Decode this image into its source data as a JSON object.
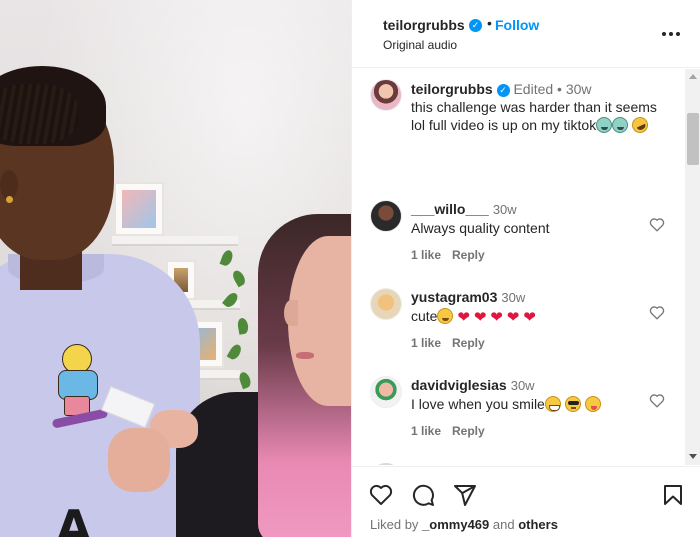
{
  "header": {
    "username": "teilorgrubbs",
    "separator": "•",
    "follow_label": "Follow",
    "audio_label": "Original audio",
    "more_icon": "more-horizontal-icon"
  },
  "caption": {
    "username": "teilorgrubbs",
    "edited_label": "Edited",
    "separator": "•",
    "time": "30w",
    "text": "this challenge was harder than it seems lol full video is up on my tiktok",
    "emojis": [
      "crying-face",
      "crying-face",
      "rolling-on-floor-laughing"
    ]
  },
  "comments": [
    {
      "username": "___willo___",
      "time": "30w",
      "text": "Always quality content",
      "likes": "1 like",
      "reply_label": "Reply"
    },
    {
      "username": "yustagram03",
      "time": "30w",
      "text": "cute",
      "emojis": [
        "smiling-face",
        "heart",
        "heart",
        "heart",
        "heart",
        "heart"
      ],
      "likes": "1 like",
      "reply_label": "Reply"
    },
    {
      "username": "davidviglesias",
      "time": "30w",
      "text": "I love when you smile",
      "emojis": [
        "grinning-face",
        "sunglasses-face",
        "zany-face"
      ],
      "likes": "1 like",
      "reply_label": "Reply"
    }
  ],
  "actions": {
    "icons": [
      "heart-icon",
      "comment-icon",
      "share-icon",
      "bookmark-icon"
    ],
    "liked_by_prefix": "Liked by",
    "liked_by_user": "_ommy469",
    "liked_by_and": "and",
    "liked_by_others": "others"
  },
  "video": {
    "overlay_text": "A"
  },
  "colors": {
    "accent": "#0095f6",
    "text": "#262626",
    "muted": "#737373",
    "heart_red": "#e0163f"
  }
}
